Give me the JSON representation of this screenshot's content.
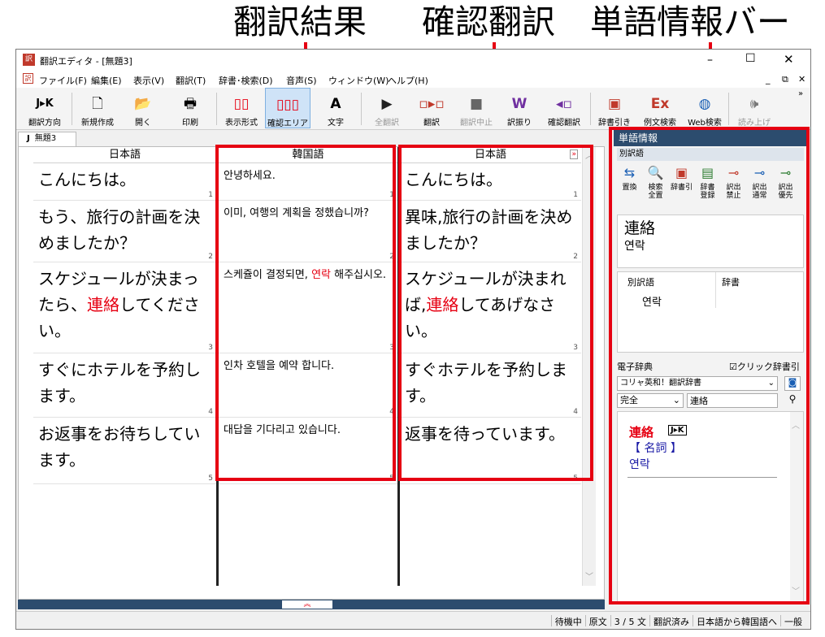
{
  "callouts": [
    "翻訳結果",
    "確認翻訳",
    "単語情報バー"
  ],
  "window": {
    "app_title": "翻訳エディタ - [無題3]"
  },
  "menu": [
    "ファイル(F)",
    "編集(E)",
    "表示(V)",
    "翻訳(T)",
    "辞書･検索(D)",
    "音声(S)",
    "ウィンドウ(W)",
    "ヘルプ(H)"
  ],
  "toolbar": {
    "direction": "翻訳方向",
    "direction_icon": "J▸K",
    "new": "新規作成",
    "open": "開く",
    "print": "印刷",
    "layout": "表示形式",
    "confirm_area": "確認エリア",
    "text": "文字",
    "text_icon": "A",
    "all_translate": "全翻訳",
    "translate": "翻訳",
    "stop": "翻訳中止",
    "pair": "訳振り",
    "confirm_translate": "確認翻訳",
    "dict_lookup": "辞書引き",
    "example_search": "例文検索",
    "web_search": "Web検索",
    "read_aloud": "読み上げ"
  },
  "doc_tab": {
    "icon": "J",
    "label": "無題3"
  },
  "columns": {
    "left_header": "日本語",
    "mid_header": "韓国語",
    "right_header": "日本語"
  },
  "segments": [
    {
      "num": "1",
      "ja": [
        [
          "こんにちは。",
          ""
        ]
      ],
      "ko": [
        [
          "안녕하세요.",
          ""
        ]
      ],
      "back": [
        [
          "こんにちは。",
          ""
        ]
      ]
    },
    {
      "num": "2",
      "ja": [
        [
          "もう、旅行の計画を決めましたか？",
          ""
        ]
      ],
      "ko": [
        [
          "이미, 여행의 계획을 정했습니까?",
          ""
        ]
      ],
      "back": [
        [
          "異味,旅行の計画を決めましたか？",
          ""
        ]
      ]
    },
    {
      "num": "3",
      "ja": [
        [
          "スケジュールが決まったら、",
          ""
        ],
        [
          "連絡",
          "red"
        ],
        [
          "してください。",
          ""
        ]
      ],
      "ko": [
        [
          "스케쥴이 결정되면, ",
          ""
        ],
        [
          "연락",
          "red"
        ],
        [
          " 해주십시오.",
          ""
        ]
      ],
      "back": [
        [
          "スケジュールが決まれば,",
          ""
        ],
        [
          "連絡",
          "red"
        ],
        [
          "してあげなさい。",
          ""
        ]
      ]
    },
    {
      "num": "4",
      "ja": [
        [
          "すぐにホテルを予約します。",
          ""
        ]
      ],
      "ko": [
        [
          "인차 호텔을 예약 합니다.",
          ""
        ]
      ],
      "back": [
        [
          "すぐホテルを予約します。",
          ""
        ]
      ]
    },
    {
      "num": "5",
      "ja": [
        [
          "お返事をお待ちしています。",
          ""
        ]
      ],
      "ko": [
        [
          "대답을 기다리고 있습니다.",
          ""
        ]
      ],
      "back": [
        [
          "返事を待っています。",
          ""
        ]
      ]
    }
  ],
  "wordinfo": {
    "title": "単語情報",
    "alt_label": "別訳語",
    "btns": [
      "置換",
      "検索\n全置",
      "辞書引",
      "辞書\n登録",
      "訳出\n禁止",
      "訳出\n通常",
      "訳出\n優先"
    ],
    "word": "連絡",
    "trans": "연락",
    "table_h1": "別訳語",
    "table_h2": "辞書",
    "table_v1": "연락"
  },
  "edict": {
    "label": "電子辞典",
    "click_label": "クリック辞書引",
    "dict_select": "コリャ英和！翻訳辞書",
    "match": "完全",
    "query": "連絡",
    "entry_word": "連絡",
    "entry_badge": "J▸K",
    "entry_pos": "【 名詞 】",
    "entry_trans": "연락"
  },
  "status": [
    "待機中",
    "原文",
    "3 / 5 文",
    "翻訳済み",
    "日本語から韓国語へ",
    "一般"
  ],
  "colors": {
    "accent": "#e60012",
    "panel_title": "#2c4c6e",
    "link": "#1a1aa6"
  }
}
